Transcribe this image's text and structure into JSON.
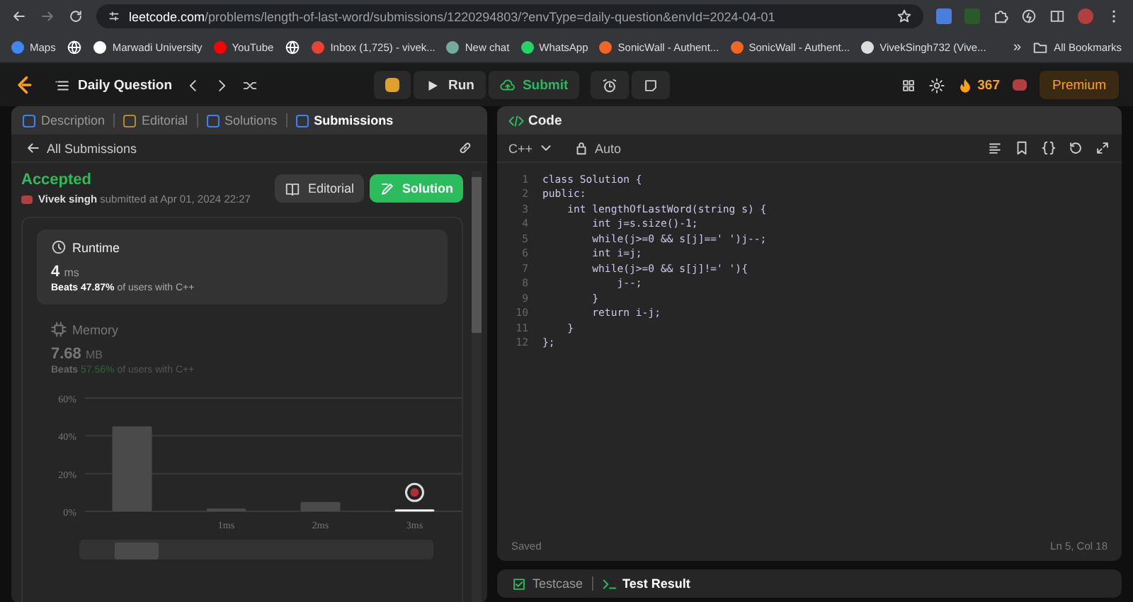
{
  "browser": {
    "url_host": "leetcode.com",
    "url_path": "/problems/length-of-last-word/submissions/1220294803/?envType=daily-question&envId=2024-04-01",
    "bookmarks": [
      {
        "kind": "link",
        "label": "Maps",
        "color": "#4285f4"
      },
      {
        "kind": "icon",
        "color": "#ffffff"
      },
      {
        "kind": "link",
        "label": "Marwadi University",
        "color": "#ffffff"
      },
      {
        "kind": "link",
        "label": "YouTube",
        "color": "#ff0000"
      },
      {
        "kind": "icon",
        "color": "#ffffff"
      },
      {
        "kind": "link",
        "label": "Inbox (1,725) - vivek...",
        "color": "#ea4335"
      },
      {
        "kind": "link",
        "label": "New chat",
        "color": "#74aa9c"
      },
      {
        "kind": "link",
        "label": "WhatsApp",
        "color": "#25d366"
      },
      {
        "kind": "link",
        "label": "SonicWall - Authent...",
        "color": "#f26522"
      },
      {
        "kind": "link",
        "label": "SonicWall - Authent...",
        "color": "#f26522"
      },
      {
        "kind": "link",
        "label": "VivekSingh732 (Vive...",
        "color": "#dddddd"
      }
    ],
    "overflow": "»",
    "all_bookmarks": "All Bookmarks"
  },
  "nav": {
    "title": "Daily Question",
    "run": "Run",
    "submit": "Submit",
    "streak": "367",
    "premium": "Premium"
  },
  "left_tabs": [
    {
      "label": "Description",
      "selected": false,
      "color": "#3b82f6"
    },
    {
      "label": "Editorial",
      "selected": false,
      "color": "#b58a2e"
    },
    {
      "label": "Solutions",
      "selected": false,
      "color": "#3b82f6"
    },
    {
      "label": "Submissions",
      "selected": true,
      "color": "#3b82f6"
    }
  ],
  "back_label": "All Submissions",
  "submission": {
    "status": "Accepted",
    "user": "Vivek singh",
    "submitted": "submitted at Apr 01, 2024 22:27",
    "editorial": "Editorial",
    "solution": "Solution"
  },
  "runtime": {
    "title": "Runtime",
    "value": "4",
    "unit": "ms",
    "beats_label": "Beats",
    "beats_value": "47.87%",
    "beats_rest": "of users with C++"
  },
  "memory": {
    "title": "Memory",
    "value": "7.68",
    "unit": "MB",
    "beats_label": "Beats",
    "beats_value": "57.56%",
    "beats_rest": "of users with C++",
    "chart_data": {
      "type": "bar",
      "x": [
        0,
        1,
        2,
        3
      ],
      "xlim": [
        -0.5,
        3.5
      ],
      "series": [
        {
          "color": "#4a4a4a",
          "values": [
            45,
            1.5,
            5,
            null
          ]
        },
        {
          "color": "#ffffff",
          "values": [
            null,
            null,
            null,
            1
          ]
        }
      ],
      "ylim": [
        0,
        60
      ],
      "yticks": [
        {
          "value": 0,
          "label": "0%"
        },
        {
          "value": 20,
          "label": "20%"
        },
        {
          "value": 40,
          "label": "40%"
        },
        {
          "value": 60,
          "label": "60%"
        }
      ],
      "xticks": [
        {
          "value": 1,
          "label": "1ms"
        },
        {
          "value": 2,
          "label": "2ms"
        },
        {
          "value": 3,
          "label": "3ms"
        }
      ]
    }
  },
  "code_panel": {
    "title": "Code",
    "language": "C++",
    "mode": "Auto",
    "lines": [
      {
        "number": "1",
        "text": "class Solution {"
      },
      {
        "number": "2",
        "text": "public:"
      },
      {
        "number": "3",
        "text": "    int lengthOfLastWord(string s) {"
      },
      {
        "number": "4",
        "text": "        int j=s.size()-1;"
      },
      {
        "number": "5",
        "text": "        while(j>=0 && s[j]==' ')j--;"
      },
      {
        "number": "6",
        "text": "        int i=j;"
      },
      {
        "number": "7",
        "text": "        while(j>=0 && s[j]!=' '){"
      },
      {
        "number": "8",
        "text": "            j--;"
      },
      {
        "number": "9",
        "text": "        }"
      },
      {
        "number": "10",
        "text": "        return i-j;"
      },
      {
        "number": "11",
        "text": "    }"
      },
      {
        "number": "12",
        "text": "};"
      }
    ],
    "status": "Saved",
    "cursor": "Ln 5, Col 18"
  },
  "bottom_tabs": [
    {
      "label": "Testcase",
      "selected": false
    },
    {
      "label": "Test Result",
      "selected": true
    }
  ]
}
